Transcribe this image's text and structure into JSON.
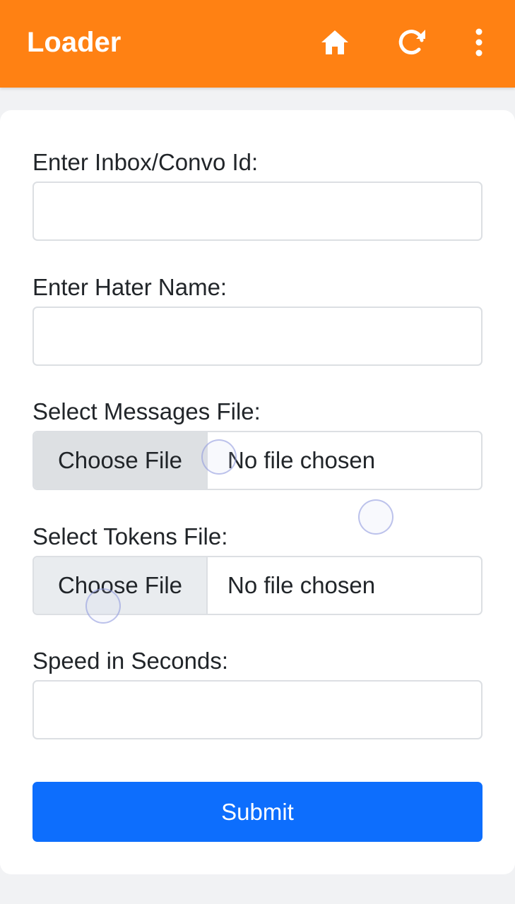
{
  "appbar": {
    "title": "Loader",
    "bg_color": "#ff8113",
    "icons": [
      "home-icon",
      "refresh-icon",
      "more-vert-icon"
    ]
  },
  "form": {
    "convo_label": "Enter Inbox/Convo Id:",
    "convo_value": "",
    "hater_label": "Enter Hater Name:",
    "hater_value": "",
    "messages_label": "Select Messages File:",
    "messages_button": "Choose File",
    "messages_status": "No file chosen",
    "tokens_label": "Select Tokens File:",
    "tokens_button": "Choose File",
    "tokens_status": "No file chosen",
    "speed_label": "Speed in Seconds:",
    "speed_value": "",
    "submit_label": "Submit",
    "submit_color": "#0d6efd"
  }
}
